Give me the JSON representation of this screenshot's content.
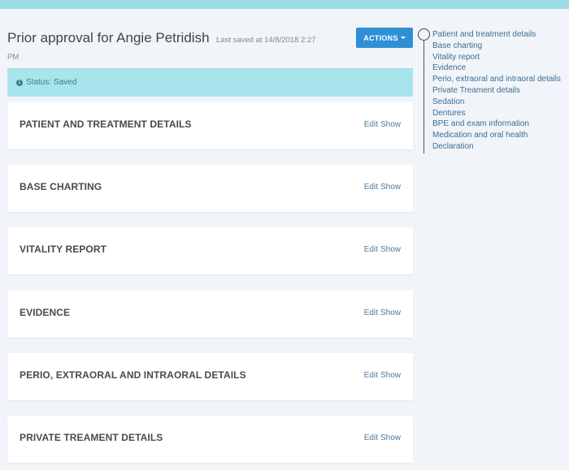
{
  "header": {
    "title": "Prior approval for Angie Petridish",
    "last_saved_line1": "Last saved at 14/8/2018 2:27",
    "last_saved_line2": "PM"
  },
  "actions": {
    "label": "ACTIONS"
  },
  "status": {
    "text": "Status: Saved",
    "icon": "info-icon"
  },
  "sections": [
    {
      "title": "PATIENT AND TREATMENT DETAILS",
      "edit": "Edit",
      "show": "Show"
    },
    {
      "title": "BASE CHARTING",
      "edit": "Edit",
      "show": "Show"
    },
    {
      "title": "VITALITY REPORT",
      "edit": "Edit",
      "show": "Show"
    },
    {
      "title": "EVIDENCE",
      "edit": "Edit",
      "show": "Show"
    },
    {
      "title": "PERIO, EXTRAORAL AND INTRAORAL DETAILS",
      "edit": "Edit",
      "show": "Show"
    },
    {
      "title": "PRIVATE TREAMENT DETAILS",
      "edit": "Edit",
      "show": "Show"
    }
  ],
  "toc": [
    "Patient and treatment details",
    "Base charting",
    "Vitality report",
    "Evidence",
    "Perio, extraoral and intraoral details",
    "Private Treament details",
    "Sedation",
    "Dentures",
    "BPE and exam information",
    "Medication and oral health",
    "Declaration"
  ],
  "colors": {
    "top_bar": "#9bdbe4",
    "accent": "#2f8fd4",
    "status_bg": "#a8e4eb",
    "link": "#3c6d96"
  }
}
